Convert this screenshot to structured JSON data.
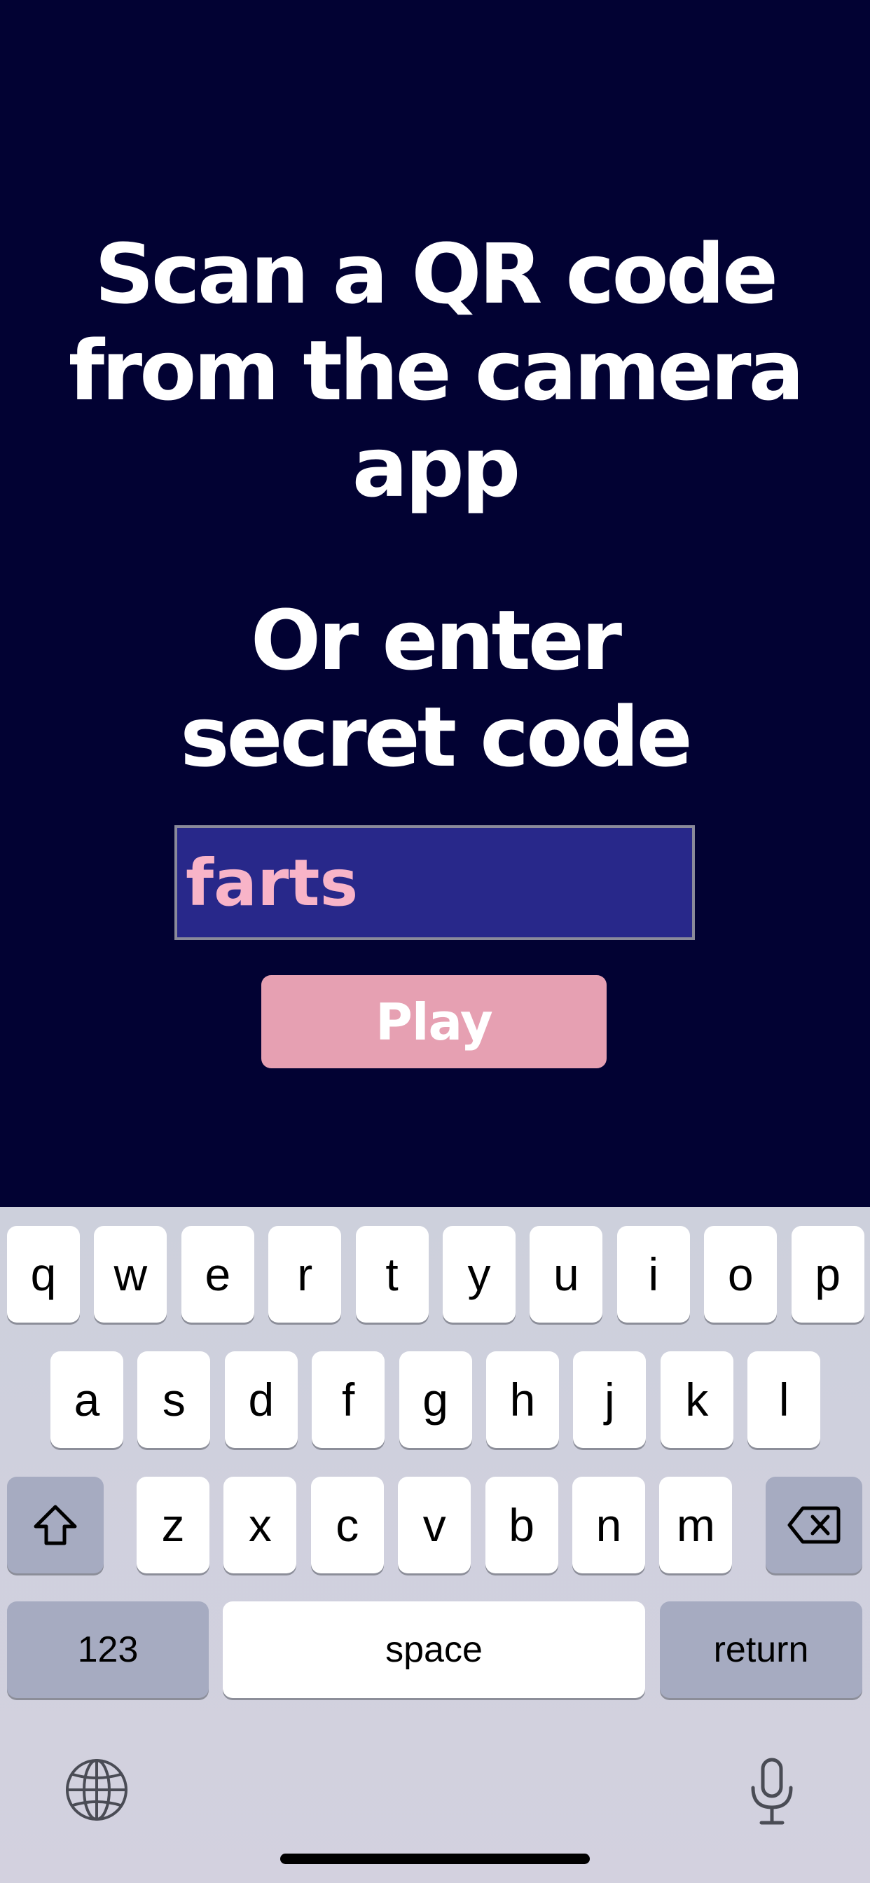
{
  "title": {
    "line1": "Scan a QR code",
    "line2": "from the camera app"
  },
  "subtitle": {
    "line1": "Or enter",
    "line2": "secret code"
  },
  "code_input": {
    "value": "farts"
  },
  "play_button": {
    "label": "Play"
  },
  "keyboard": {
    "row1": [
      "q",
      "w",
      "e",
      "r",
      "t",
      "y",
      "u",
      "i",
      "o",
      "p"
    ],
    "row2": [
      "a",
      "s",
      "d",
      "f",
      "g",
      "h",
      "j",
      "k",
      "l"
    ],
    "row3": [
      "z",
      "x",
      "c",
      "v",
      "b",
      "n",
      "m"
    ],
    "numbers_label": "123",
    "space_label": "space",
    "return_label": "return",
    "shift_icon": "shift-icon",
    "delete_icon": "delete-icon",
    "globe_icon": "globe-icon",
    "mic_icon": "microphone-icon"
  },
  "colors": {
    "background": "#020233",
    "input_background": "#28288a",
    "input_text": "#f8b4c8",
    "button": "#e6a0b2"
  }
}
